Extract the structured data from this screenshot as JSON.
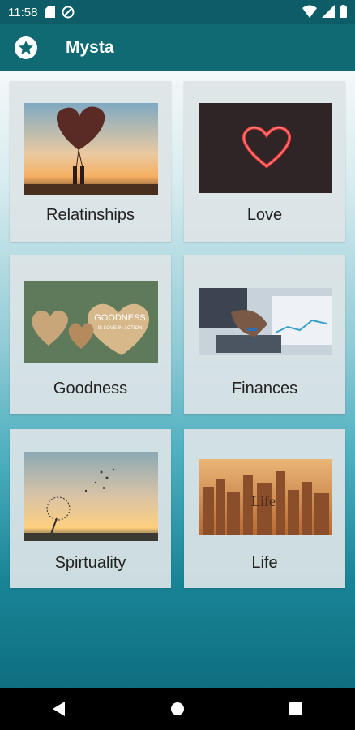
{
  "status_bar": {
    "time": "11:58"
  },
  "app_bar": {
    "title": "Mysta",
    "icon": "star-circle-icon"
  },
  "cards": [
    {
      "label": "Relatinships",
      "image": "couple-with-heart-balloons-photo"
    },
    {
      "label": "Love",
      "image": "neon-heart-photo"
    },
    {
      "label": "Goodness",
      "image": "wooden-hearts-photo",
      "image_text": "GOODNESS",
      "image_subtext": "IS LOVE IN ACTION"
    },
    {
      "label": "Finances",
      "image": "calculator-documents-photo"
    },
    {
      "label": "Spirtuality",
      "image": "dandelion-sunset-photo"
    },
    {
      "label": "Life",
      "image": "city-skyline-sunset-photo",
      "image_text": "Life"
    }
  ],
  "nav_bar": {
    "back": "back-icon",
    "home": "home-icon",
    "recents": "recents-icon"
  }
}
